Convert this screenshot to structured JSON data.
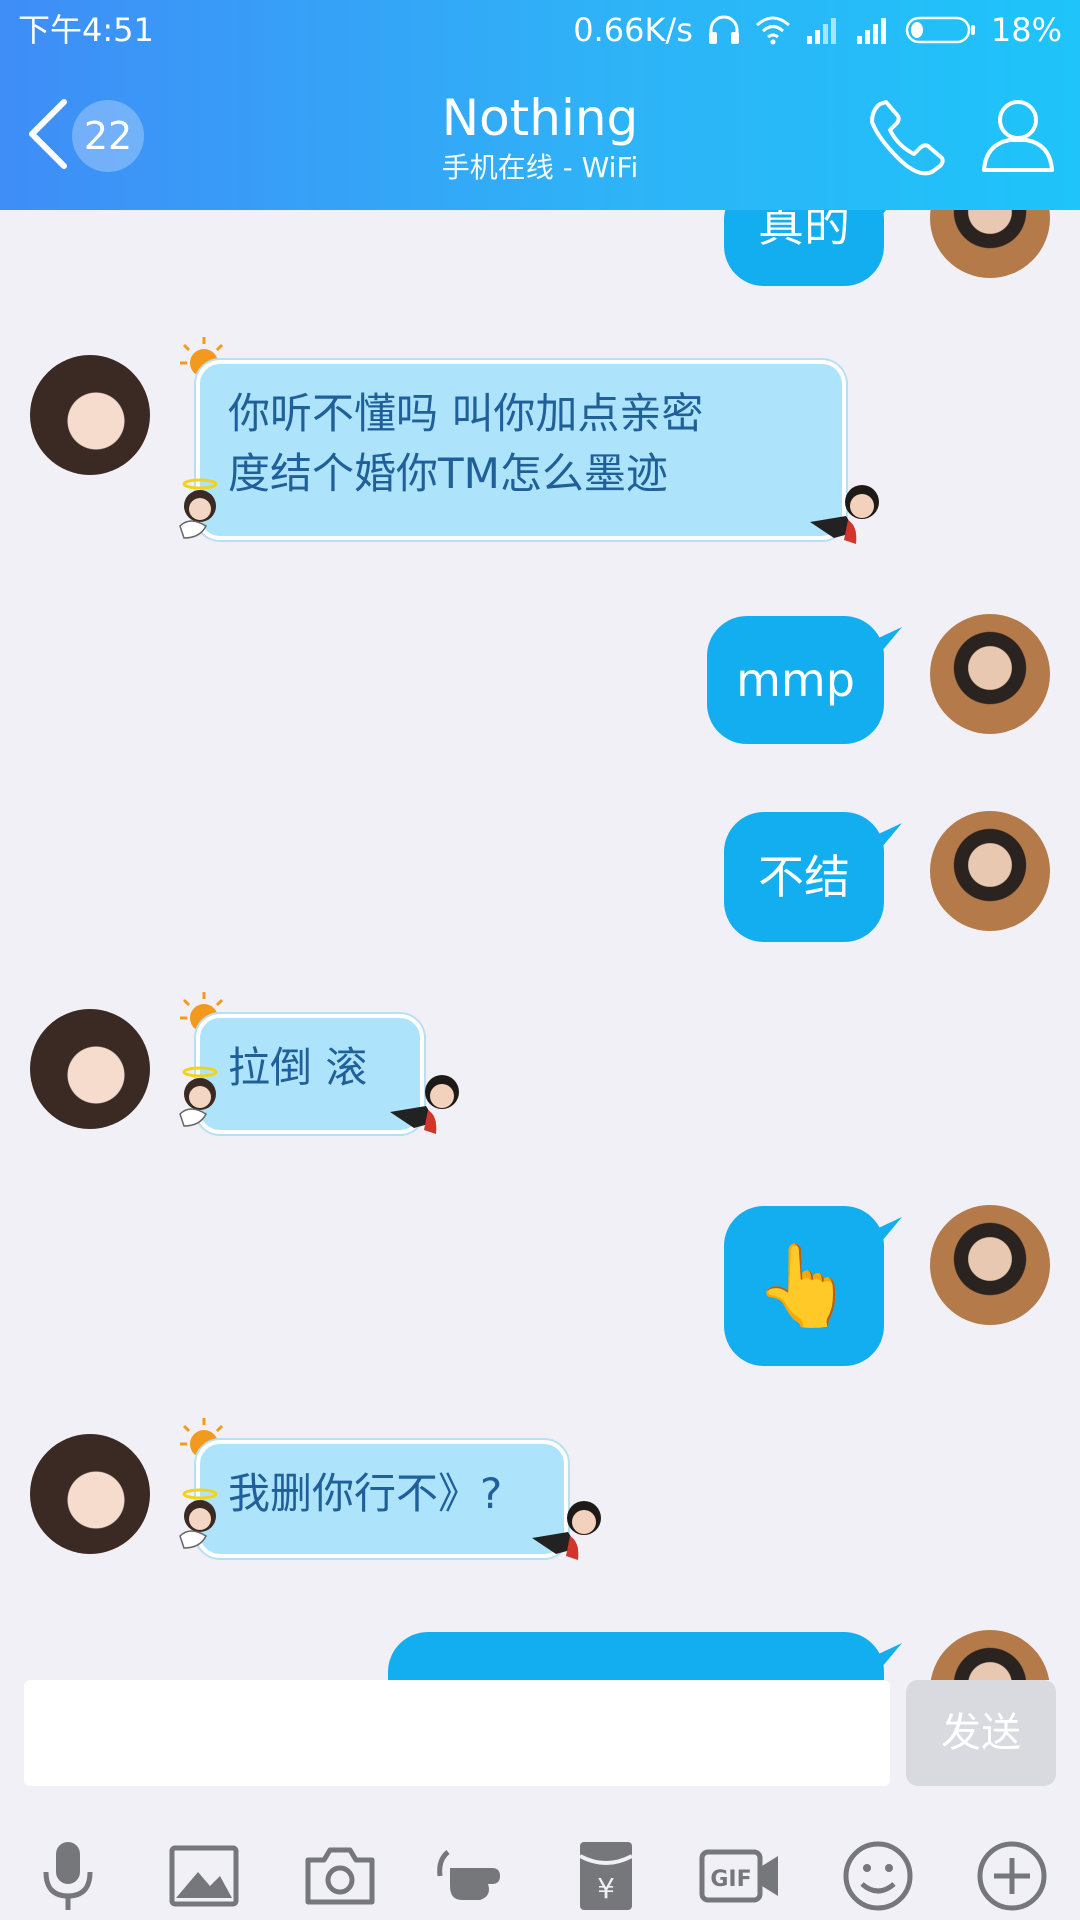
{
  "status_bar": {
    "time": "下午4:51",
    "net_speed": "0.66K/s",
    "battery": "18%"
  },
  "header": {
    "unread_count": "22",
    "title": "Nothing",
    "subtitle": "手机在线 - WiFi"
  },
  "messages": [
    {
      "from": "me",
      "text": "真的"
    },
    {
      "from": "her",
      "lines": [
        "你听不懂吗   叫你加点亲密",
        "度结个婚你TM怎么墨迹"
      ]
    },
    {
      "from": "me",
      "text": "mmp"
    },
    {
      "from": "me",
      "text": "不结"
    },
    {
      "from": "her",
      "text": "拉倒  滚"
    },
    {
      "from": "me",
      "emoji": "👆"
    },
    {
      "from": "her",
      "text": "我删你行不》?"
    }
  ],
  "input": {
    "placeholder": "",
    "send_label": "发送"
  },
  "toolbar": [
    "microphone-icon",
    "image-icon",
    "camera-icon",
    "poke-icon",
    "red-packet-icon",
    "gif-icon",
    "emoji-icon",
    "plus-icon"
  ],
  "colors": {
    "header_start": "#3f8df7",
    "header_end": "#1ec4fa",
    "outgoing_bubble": "#12aef0",
    "incoming_bubble": "#aee4fb",
    "incoming_text": "#1f5f9a"
  }
}
